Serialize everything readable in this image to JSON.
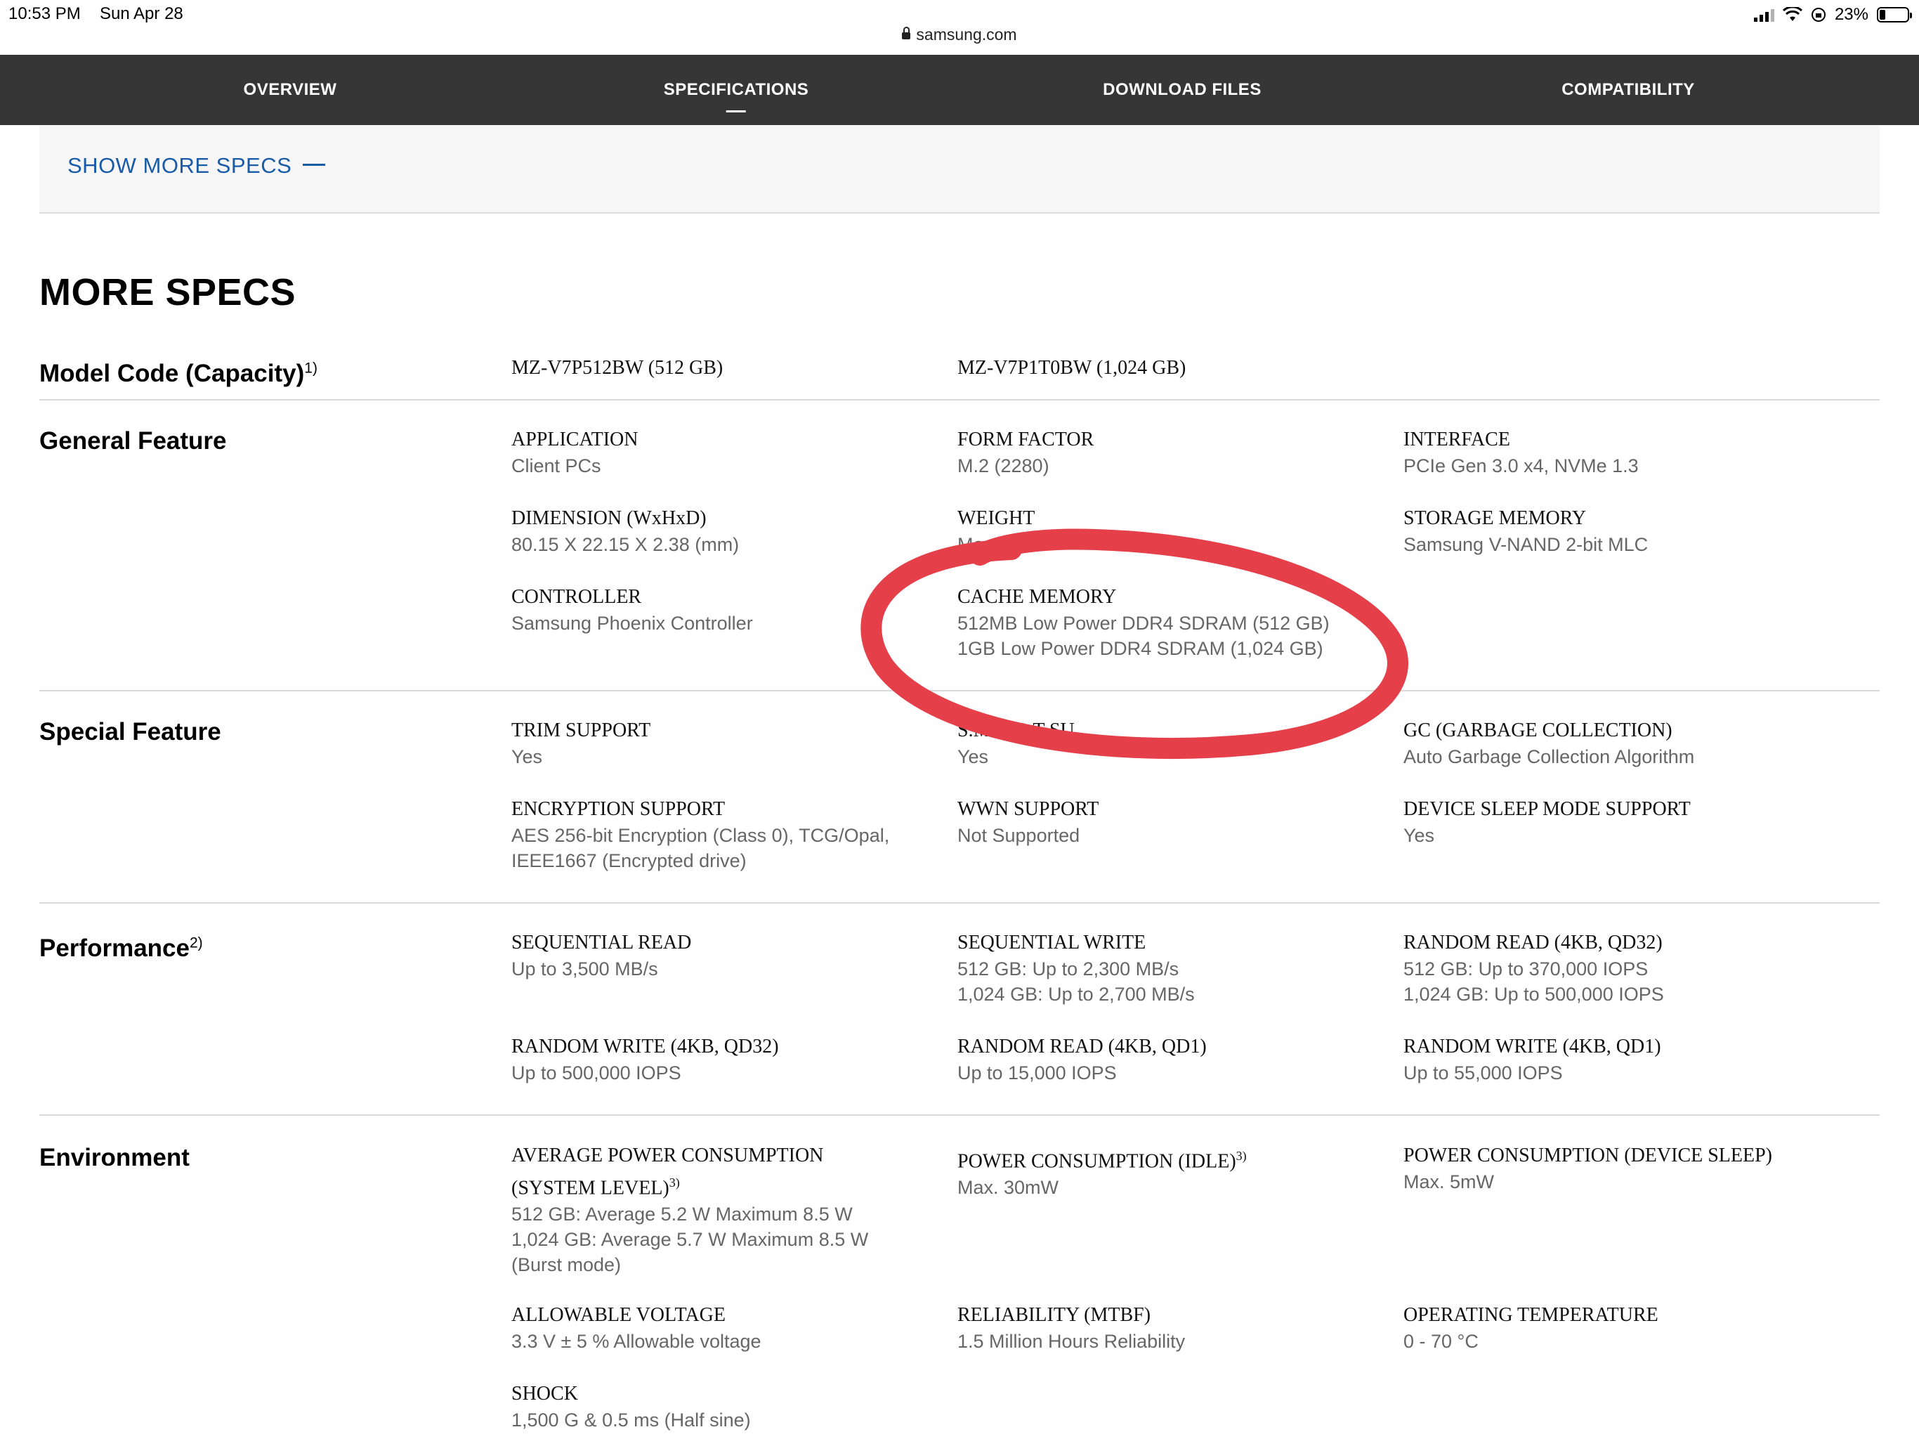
{
  "status_bar": {
    "time": "10:53 PM",
    "date": "Sun Apr 28",
    "battery": "23%"
  },
  "url_bar": {
    "domain": "samsung.com"
  },
  "nav": {
    "tabs": [
      {
        "label": "OVERVIEW",
        "active": false
      },
      {
        "label": "SPECIFICATIONS",
        "active": true
      },
      {
        "label": "DOWNLOAD FILES",
        "active": false
      },
      {
        "label": "COMPATIBILITY",
        "active": false
      }
    ]
  },
  "show_more": {
    "label": "SHOW MORE SPECS"
  },
  "more_specs": {
    "title": "MORE SPECS",
    "model_code": {
      "label": "Model Code (Capacity)",
      "sup": "1)",
      "values": [
        "MZ-V7P512BW (512 GB)",
        "MZ-V7P1T0BW (1,024 GB)"
      ]
    },
    "general": {
      "label": "General Feature",
      "items": [
        {
          "title": "APPLICATION",
          "value": "Client PCs"
        },
        {
          "title": "FORM FACTOR",
          "value": "M.2 (2280)"
        },
        {
          "title": "INTERFACE",
          "value": "PCIe Gen 3.0 x4, NVMe 1.3"
        },
        {
          "title": "DIMENSION (WxHxD)",
          "value": "80.15 X 22.15 X 2.38 (mm)"
        },
        {
          "title": "WEIGHT",
          "value": "Max. 8"
        },
        {
          "title": "STORAGE MEMORY",
          "value": "Samsung V-NAND 2-bit MLC"
        },
        {
          "title": "CONTROLLER",
          "value": "Samsung Phoenix Controller"
        },
        {
          "title": "CACHE MEMORY",
          "value": "512MB Low Power DDR4 SDRAM (512 GB)\n1GB Low Power DDR4 SDRAM (1,024 GB)"
        }
      ]
    },
    "special": {
      "label": "Special Feature",
      "items": [
        {
          "title": "TRIM SUPPORT",
          "value": "Yes"
        },
        {
          "title": "S.M.A.R.T SU",
          "value": "Yes"
        },
        {
          "title": "GC (GARBAGE COLLECTION)",
          "value": "Auto Garbage Collection Algorithm"
        },
        {
          "title": "ENCRYPTION SUPPORT",
          "value": "AES 256-bit Encryption (Class 0), TCG/Opal,\nIEEE1667 (Encrypted drive)"
        },
        {
          "title": "WWN SUPPORT",
          "value": "Not Supported"
        },
        {
          "title": "DEVICE SLEEP MODE SUPPORT",
          "value": "Yes"
        }
      ]
    },
    "performance": {
      "label": "Performance",
      "sup": "2)",
      "items": [
        {
          "title": "SEQUENTIAL READ",
          "value": "Up to 3,500 MB/s"
        },
        {
          "title": "SEQUENTIAL WRITE",
          "value": "512 GB: Up to 2,300 MB/s\n1,024 GB: Up to 2,700 MB/s"
        },
        {
          "title": "RANDOM READ (4KB, QD32)",
          "value": "512 GB: Up to 370,000 IOPS\n1,024 GB: Up to 500,000 IOPS"
        },
        {
          "title": "RANDOM WRITE (4KB, QD32)",
          "value": "Up to 500,000 IOPS"
        },
        {
          "title": "RANDOM READ (4KB, QD1)",
          "value": "Up to 15,000 IOPS"
        },
        {
          "title": "RANDOM WRITE (4KB, QD1)",
          "value": "Up to 55,000 IOPS"
        }
      ]
    },
    "environment": {
      "label": "Environment",
      "items": [
        {
          "title": "AVERAGE POWER CONSUMPTION",
          "title2": "(SYSTEM LEVEL)",
          "sup": "3)",
          "value": "512 GB: Average 5.2 W Maximum 8.5 W\n1,024 GB: Average 5.7 W Maximum 8.5 W\n(Burst mode)"
        },
        {
          "title": "POWER CONSUMPTION (IDLE)",
          "sup": "3)",
          "value": "Max. 30mW"
        },
        {
          "title": "POWER CONSUMPTION (DEVICE SLEEP)",
          "value": "Max. 5mW"
        },
        {
          "title": "ALLOWABLE VOLTAGE",
          "value": "3.3 V ± 5 % Allowable voltage"
        },
        {
          "title": "RELIABILITY (MTBF)",
          "value": "1.5 Million Hours Reliability"
        },
        {
          "title": "OPERATING TEMPERATURE",
          "value": "0 - 70 °C"
        },
        {
          "title": "SHOCK",
          "value": "1,500 G & 0.5 ms (Half sine)"
        }
      ]
    }
  },
  "annotation": {
    "color": "#e5404a"
  }
}
